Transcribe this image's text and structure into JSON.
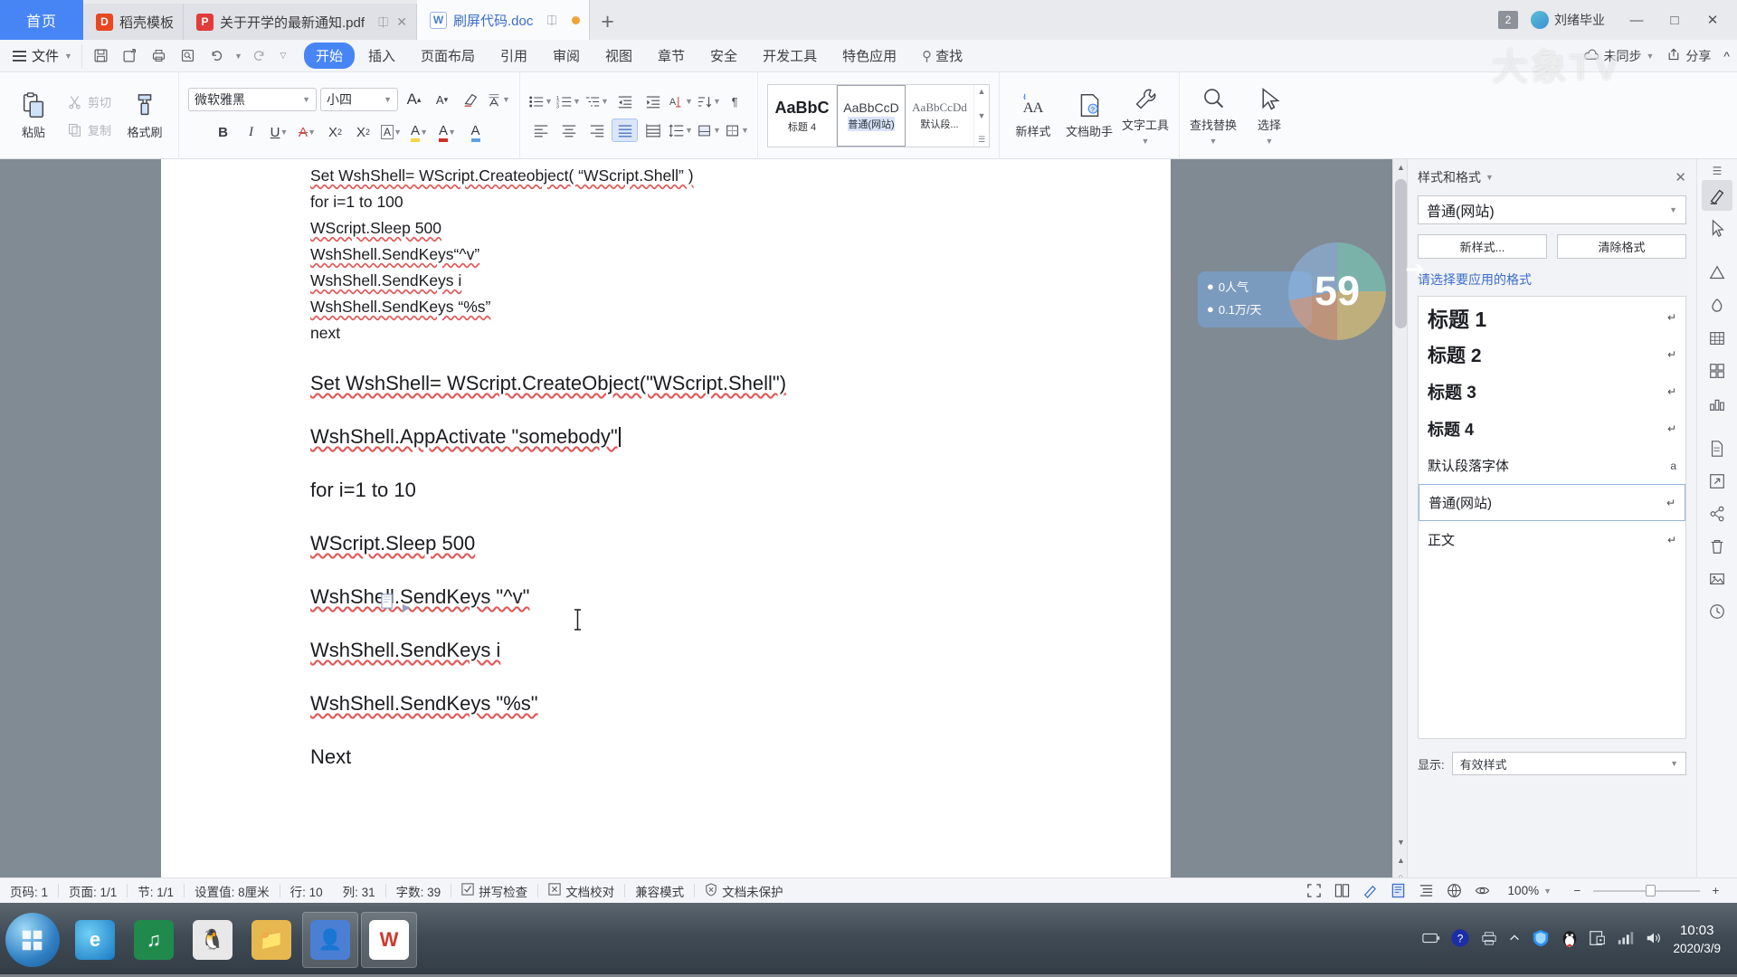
{
  "window": {
    "app": "WPS Office",
    "tabs": [
      {
        "label": "首页",
        "type": "home"
      },
      {
        "label": "稻壳模板",
        "icon": "wps-docer-icon",
        "type": "docer"
      },
      {
        "label": "关于开学的最新通知.pdf",
        "icon": "pdf-icon",
        "type": "pdf"
      },
      {
        "label": "刷屏代码.doc",
        "icon": "word-icon",
        "type": "doc",
        "active": true
      }
    ],
    "new_tab_label": "+",
    "badge": "2",
    "user_name": "刘绪毕业",
    "minimize": "—",
    "maximize": "□",
    "close": "✕"
  },
  "menu": {
    "file_label": "文件",
    "quick_access": [
      "save-icon",
      "save-as-icon",
      "print-icon",
      "print-preview-icon",
      "undo-icon",
      "redo-icon",
      "customize-icon"
    ],
    "ribbon_tabs": [
      {
        "label": "开始",
        "active": true
      },
      {
        "label": "插入",
        "active": false
      },
      {
        "label": "页面布局",
        "active": false
      },
      {
        "label": "引用",
        "active": false
      },
      {
        "label": "审阅",
        "active": false
      },
      {
        "label": "视图",
        "active": false
      },
      {
        "label": "章节",
        "active": false
      },
      {
        "label": "安全",
        "active": false
      },
      {
        "label": "开发工具",
        "active": false
      },
      {
        "label": "特色应用",
        "active": false
      },
      {
        "label": "查找",
        "active": false,
        "icon": "search-icon"
      }
    ],
    "sync_label": "未同步",
    "share_label": "分享",
    "collapse_label": "^"
  },
  "ribbon": {
    "clipboard": {
      "paste": "粘贴",
      "cut": "剪切",
      "copy": "复制",
      "format_painter": "格式刷"
    },
    "font": {
      "family": "微软雅黑",
      "size": "小四",
      "grow": "A",
      "shrink": "A",
      "clear_format": "清除格式",
      "pinyin": "拼音指南",
      "bold": "B",
      "italic": "I",
      "underline": "U",
      "strike": "A",
      "superscript": "X",
      "subscript": "X",
      "char_border": "A",
      "highlight": "A",
      "font_color": "A",
      "char_shading": "A"
    },
    "paragraph": {
      "bullets": "项目符号",
      "numbering": "编号",
      "multilevel": "多级列表",
      "dec_indent": "减少缩进量",
      "inc_indent": "增加缩进量",
      "asian_layout": "中文版式",
      "sort": "排序",
      "line_number": "行号",
      "show_marks": "显示/隐藏编辑标记",
      "align_left": "左对齐",
      "align_center": "居中",
      "align_right": "右对齐",
      "align_justify": "两端对齐",
      "distribute": "分散对齐",
      "line_spacing": "行距",
      "shading": "底纹",
      "borders": "边框"
    },
    "styles": [
      {
        "preview": "AaBbC",
        "name": "标题 4",
        "selected": false
      },
      {
        "preview": "AaBbCcD",
        "name": "普通(网站)",
        "selected": true
      },
      {
        "preview": "AaBbCcDd",
        "name": "默认段...",
        "selected": false
      }
    ],
    "tools": [
      {
        "label": "新样式",
        "icon": "new-style-icon"
      },
      {
        "label": "文档助手",
        "icon": "doc-assistant-icon"
      },
      {
        "label": "文字工具",
        "icon": "wrench-icon"
      },
      {
        "label": "查找替换",
        "icon": "search-icon"
      },
      {
        "label": "选择",
        "icon": "pointer-icon"
      }
    ]
  },
  "document": {
    "block1": [
      "Set WshShell= WScript.Createobject( “WScript.Shell” )",
      "for i=1 to 100",
      "WScript.Sleep 500",
      "WshShell.SendKeys“^v”",
      "WshShell.SendKeys i",
      "WshShell.SendKeys  “%s”",
      "next"
    ],
    "block2": [
      "Set WshShell= WScript.CreateObject(\"WScript.Shell\")",
      "WshShell.AppActivate \"somebody\"",
      "for i=1 to 10",
      "WScript.Sleep 500",
      "WshShell.SendKeys \"^v\"",
      "WshShell.SendKeys i",
      "WshShell.SendKeys \"%s\"",
      "Next"
    ]
  },
  "pane": {
    "title": "样式和格式",
    "close": "✕",
    "current_style": "普通(网站)",
    "new_style_button": "新样式...",
    "clear_format_button": "清除格式",
    "hint": "请选择要应用的格式",
    "styles": [
      {
        "name": "标题 1",
        "mark": "↵",
        "cls": "st-h1",
        "selected": false
      },
      {
        "name": "标题 2",
        "mark": "↵",
        "cls": "st-h2",
        "selected": false
      },
      {
        "name": "标题 3",
        "mark": "↵",
        "cls": "st-h3",
        "selected": false
      },
      {
        "name": "标题 4",
        "mark": "↵",
        "cls": "st-h4",
        "selected": false
      },
      {
        "name": "默认段落字体",
        "mark": "a",
        "cls": "st-n",
        "selected": false
      },
      {
        "name": "普通(网站)",
        "mark": "↵",
        "cls": "st-n",
        "selected": true
      },
      {
        "name": "正文",
        "mark": "↵",
        "cls": "st-n",
        "selected": false
      }
    ],
    "show_label": "显示:",
    "show_value": "有效样式"
  },
  "rail": [
    {
      "name": "styles-pane-icon",
      "active": true
    },
    {
      "name": "selection-pane-icon",
      "active": false
    },
    {
      "name": "shapes-pane-icon",
      "active": false
    },
    {
      "name": "chart-pane-icon",
      "active": false
    },
    {
      "name": "table-pane-icon",
      "active": false
    },
    {
      "name": "grid-pane-icon",
      "active": false
    },
    {
      "name": "stats-pane-icon",
      "active": false
    },
    {
      "name": "file-pane-icon",
      "active": false
    },
    {
      "name": "export-pane-icon",
      "active": false
    },
    {
      "name": "share-pane-icon",
      "active": false
    },
    {
      "name": "recycle-pane-icon",
      "active": false
    },
    {
      "name": "image-pane-icon",
      "active": false
    },
    {
      "name": "cloud-pane-icon",
      "active": false
    }
  ],
  "status": {
    "items": [
      {
        "label": "页码: 1"
      },
      {
        "label": "页面: 1/1"
      },
      {
        "label": "节: 1/1"
      },
      {
        "label": "设置值: 8厘米"
      },
      {
        "label": "行: 10"
      },
      {
        "label": "列: 31"
      },
      {
        "label": "字数: 39"
      },
      {
        "label": "拼写检查",
        "icon": "spellcheck-icon"
      },
      {
        "label": "文档校对",
        "icon": "proofread-icon"
      },
      {
        "label": "兼容模式"
      },
      {
        "label": "文档未保护",
        "icon": "shield-icon"
      }
    ],
    "views": [
      "fullscreen-icon",
      "two-page-icon",
      "read-layout-icon",
      "edit-icon",
      "page-layout-icon",
      "outline-icon",
      "web-layout-icon",
      "eye-icon"
    ],
    "zoom": "100%",
    "zoom_out": "−",
    "zoom_in": "+"
  },
  "taskbar": {
    "apps": [
      {
        "name": "start-button",
        "glyph": ""
      },
      {
        "name": "edge-icon",
        "glyph": "e",
        "color": "#1ba1e2"
      },
      {
        "name": "media-player-icon",
        "glyph": "♫",
        "color": "#2fa84f"
      },
      {
        "name": "qq-icon",
        "glyph": "🐧",
        "color": "#d9d9d9"
      },
      {
        "name": "explorer-icon",
        "glyph": "📁",
        "color": "#e8c46a"
      },
      {
        "name": "app-icon",
        "glyph": "人",
        "color": "#4a7fd4"
      },
      {
        "name": "wps-icon",
        "glyph": "W",
        "color": "#cf3a2f"
      }
    ],
    "tray": [
      "battery-icon",
      "help-icon",
      "printer-icon",
      "uparrow-icon",
      "shield-icon",
      "qq-tray-icon",
      "screenshot-icon",
      "network-icon",
      "volume-icon"
    ],
    "time": "10:03",
    "date": "2020/3/9"
  },
  "watermark": {
    "brand": "大象TV",
    "counter": "59",
    "stat1": "0人气",
    "stat2": "0.1万/天"
  }
}
